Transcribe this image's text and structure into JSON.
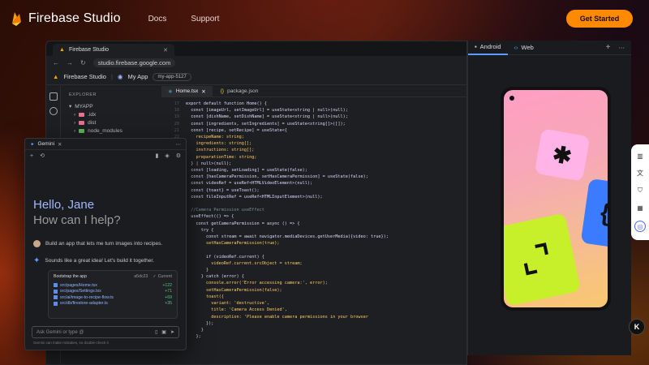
{
  "nav": {
    "brand": "Firebase Studio",
    "links": [
      "Docs",
      "Support"
    ],
    "cta": "Get Started"
  },
  "browser": {
    "tab_title": "Firebase Studio",
    "url": "studio.firebase.google.com"
  },
  "app_header": {
    "product": "Firebase Studio",
    "project": "My App",
    "project_id": "my-app-5127"
  },
  "explorer": {
    "title": "EXPLORER",
    "root": "MYAPP",
    "items": [
      ".idx",
      "dist",
      "node_modules"
    ]
  },
  "editor": {
    "tabs": [
      "Home.tsx",
      "package.json"
    ],
    "lines": [
      {
        "n": "17",
        "code": "export default function Home() {"
      },
      {
        "n": "18",
        "code": "  const [imageUrl, setImageUrl] = useState<string | null>(null);"
      },
      {
        "n": "19",
        "code": "  const [dishName, setDishName] = useState<string | null>(null);"
      },
      {
        "n": "20",
        "code": "  const [ingredients, setIngredients] = useState<string[]>([]);"
      },
      {
        "n": "21",
        "code": "  const [recipe, setRecipe] = useState<{"
      },
      {
        "n": "22",
        "code": "    recipeName: string;"
      },
      {
        "n": "23",
        "code": "    ingredients: string[];"
      },
      {
        "n": "24",
        "code": "    instructions: string[];"
      },
      {
        "n": "25",
        "code": "    preparationTime: string;"
      },
      {
        "n": "26",
        "code": "  } | null>(null);"
      },
      {
        "n": "27",
        "code": "  const [loading, setLoading] = useState(false);"
      },
      {
        "n": "28",
        "code": "  const [hasCameraPermission, setHasCameraPermission] = useState(false);"
      },
      {
        "n": "29",
        "code": "  const videoRef = useRef<HTMLVideoElement>(null);"
      },
      {
        "n": "30",
        "code": "  const {toast} = useToast();"
      },
      {
        "n": "31",
        "code": "  const fileInputRef = useRef<HTMLInputElement>(null);"
      },
      {
        "n": "32",
        "code": ""
      },
      {
        "n": "33",
        "code": "  //Camera Permission useEffect"
      },
      {
        "n": "34",
        "code": "  useEffect(() => {"
      },
      {
        "n": "35",
        "code": "    const getCameraPermission = async () => {"
      },
      {
        "n": "36",
        "code": "      try {"
      },
      {
        "n": "37",
        "code": "        const stream = await navigator.mediaDevices.getUserMedia({video: true});"
      },
      {
        "n": "38",
        "code": "        setHasCameraPermission(true);"
      },
      {
        "n": "39",
        "code": ""
      },
      {
        "n": "40",
        "code": "        if (videoRef.current) {"
      },
      {
        "n": "41",
        "code": "          videoRef.current.srcObject = stream;"
      },
      {
        "n": "42",
        "code": "        }"
      },
      {
        "n": "43",
        "code": "      } catch (error) {"
      },
      {
        "n": "44",
        "code": "        console.error('Error accessing camera:', error);"
      },
      {
        "n": "45",
        "code": "        setHasCameraPermission(false);"
      },
      {
        "n": "46",
        "code": "        toast({"
      },
      {
        "n": "47",
        "code": "          variant: 'destructive',"
      },
      {
        "n": "48",
        "code": "          title: 'Camera Access Denied',"
      },
      {
        "n": "49",
        "code": "          description: 'Please enable camera permissions in your browser"
      },
      {
        "n": "50",
        "code": "        });"
      },
      {
        "n": "51",
        "code": "      }"
      },
      {
        "n": "52",
        "code": "    };"
      }
    ]
  },
  "gemini": {
    "tab": "Gemini",
    "greeting": "Hello, Jane",
    "question": "How can I help?",
    "user_message": "Build an app that lets me turn images into recipes.",
    "reply": "Sounds like a great idea! Let's build it together.",
    "card_title": "Bootstrap the app",
    "card_hash": "a5dc23",
    "card_status": "Current",
    "files": [
      {
        "path": "src/pages/Home.tsx",
        "delta": "+122"
      },
      {
        "path": "src/pages/Settings.tsx",
        "delta": "+71"
      },
      {
        "path": "src/ai/image-to-recipe-flow.ts",
        "delta": "+69"
      },
      {
        "path": "src/db/firestore-adapter.ts",
        "delta": "+35"
      }
    ],
    "input_placeholder": "Ask Gemini or type @",
    "disclaimer": "Gemini can make mistakes, so double-check it"
  },
  "preview": {
    "tabs": [
      "Android",
      "Web"
    ]
  },
  "colors": {
    "accent": "#ff8a00",
    "gemini_blue": "#9fb8ff",
    "tile_pink": "#ffb3e6",
    "tile_lime": "#c8f02a",
    "tile_blue": "#3a7bff"
  },
  "rail": {
    "icons": [
      "book-icon",
      "translate-icon",
      "shield-icon",
      "grid-icon",
      "assistant-icon"
    ],
    "badge": "K"
  }
}
